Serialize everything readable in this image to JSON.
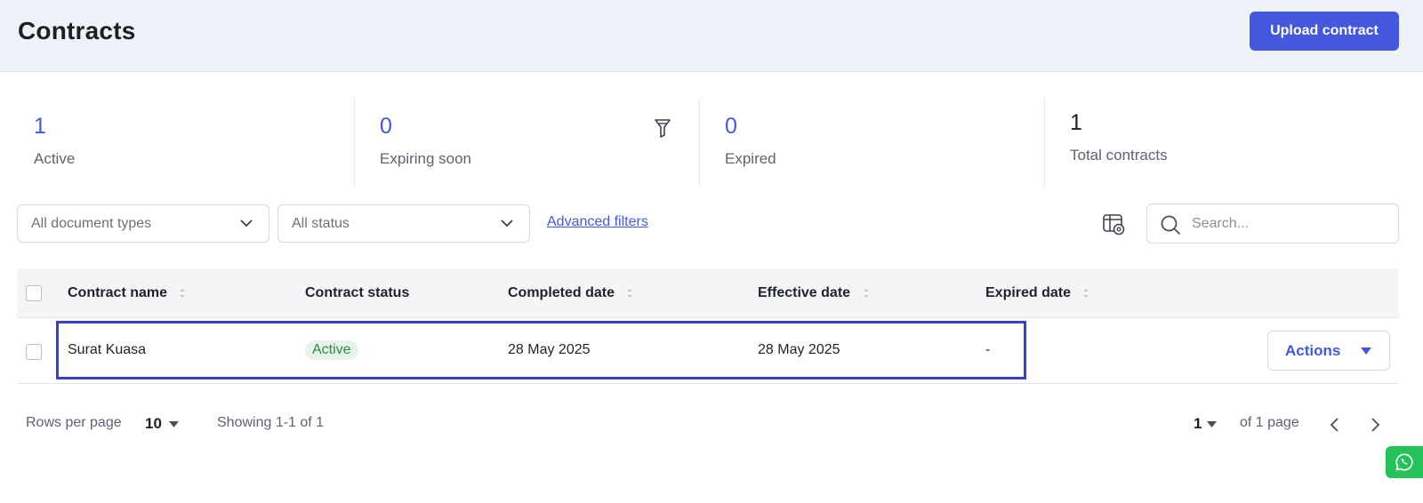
{
  "header": {
    "title": "Contracts",
    "upload_label": "Upload contract"
  },
  "stats": [
    {
      "value": "1",
      "label": "Active"
    },
    {
      "value": "0",
      "label": "Expiring soon"
    },
    {
      "value": "0",
      "label": "Expired"
    },
    {
      "value": "1",
      "label": "Total contracts"
    }
  ],
  "filters": {
    "doc_type_selected": "All document types",
    "status_selected": "All status",
    "advanced_label": "Advanced filters",
    "search_placeholder": "Search..."
  },
  "table": {
    "columns": [
      "Contract name",
      "Contract status",
      "Completed date",
      "Effective date",
      "Expired date"
    ],
    "rows": [
      {
        "name": "Surat Kuasa",
        "status": "Active",
        "completed": "28 May 2025",
        "effective": "28 May 2025",
        "expired": "-",
        "actions_label": "Actions"
      }
    ]
  },
  "pagination": {
    "rows_label": "Rows per page",
    "rows_value": "10",
    "showing": "Showing 1-1 of 1",
    "current_page": "1",
    "of_pages": "of 1 page"
  },
  "colors": {
    "accent": "#4458df",
    "header_bg": "#eff2f8",
    "active_badge_bg": "#e7f4ea",
    "active_badge_text": "#2f8a47",
    "highlight": "#3a3fc9",
    "whatsapp": "#25c25a"
  },
  "icons": {
    "filter": "funnel-icon",
    "settings": "table-settings-icon",
    "search": "search-icon",
    "sort": "sort-icon",
    "chevron": "chevron-down-icon",
    "whatsapp": "whatsapp-icon"
  }
}
